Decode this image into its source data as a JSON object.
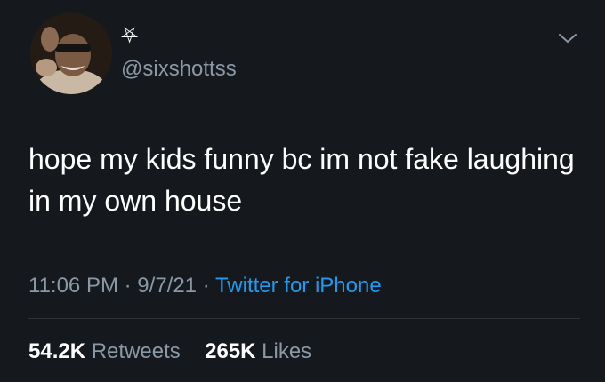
{
  "user": {
    "display_name": "⛧",
    "handle": "@sixshottss"
  },
  "tweet": {
    "text": "hope my kids funny bc im not fake laughing in my own house",
    "time": "11:06 PM",
    "date": "9/7/21",
    "separator": "·",
    "source": "Twitter for iPhone"
  },
  "stats": {
    "retweets_count": "54.2K",
    "retweets_label": "Retweets",
    "likes_count": "265K",
    "likes_label": "Likes"
  },
  "icons": {
    "more": "chevron-down-icon"
  },
  "colors": {
    "background": "#15181d",
    "secondary_text": "#8b98a5",
    "link": "#1d9bf0",
    "divider": "#2f3336"
  }
}
